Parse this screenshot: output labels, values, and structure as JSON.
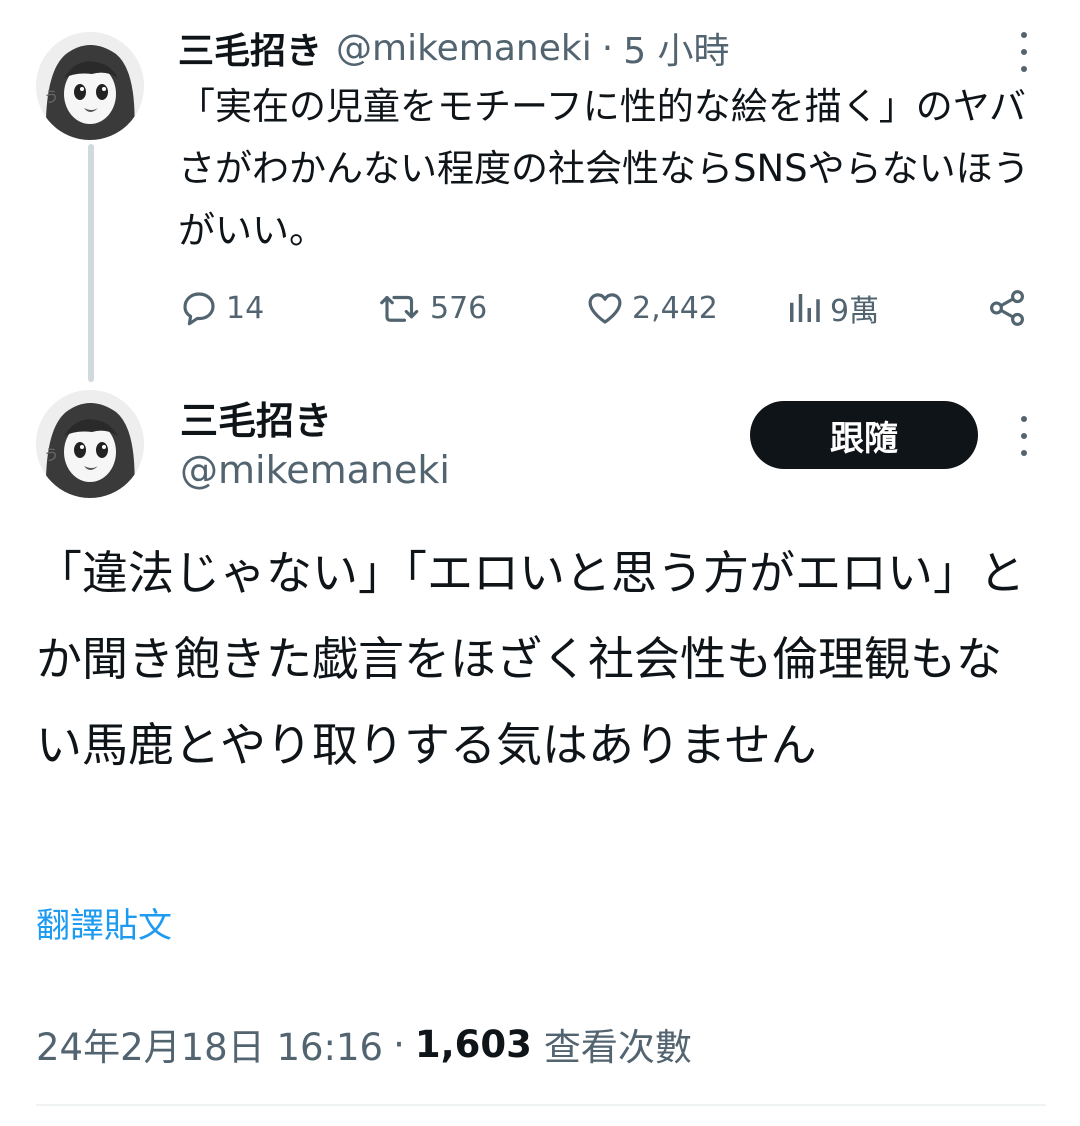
{
  "colors": {
    "text": "#0f1419",
    "secondary": "#536471",
    "link": "#1d9bf0",
    "follow_bg": "#0f1419",
    "thread_line": "#cfd9de"
  },
  "parent_tweet": {
    "name": "三毛招き",
    "handle": "@mikemaneki",
    "separator": "·",
    "time": "5 小時",
    "text": "「実在の児童をモチーフに性的な絵を描く」のヤバさがわかんない程度の社会性ならSNSやらないほうがいい。",
    "actions": {
      "replies": "14",
      "retweets": "576",
      "likes": "2,442",
      "views": "9萬"
    },
    "icons": {
      "reply": "reply-icon",
      "retweet": "retweet-icon",
      "like": "heart-icon",
      "views": "views-bar-icon",
      "share": "share-icon",
      "more": "more-vertical-icon"
    }
  },
  "main_tweet": {
    "name": "三毛招き",
    "handle": "@mikemaneki",
    "follow_label": "跟隨",
    "text": "「違法じゃない」「エロいと思う方がエロい」とか聞き飽きた戯言をほざく社会性も倫理観もない馬鹿とやり取りする気はありません",
    "translate_label": "翻譯貼文",
    "date": "24年2月18日 16:16",
    "separator": "·",
    "views_count": "1,603",
    "views_label": "查看次數"
  }
}
